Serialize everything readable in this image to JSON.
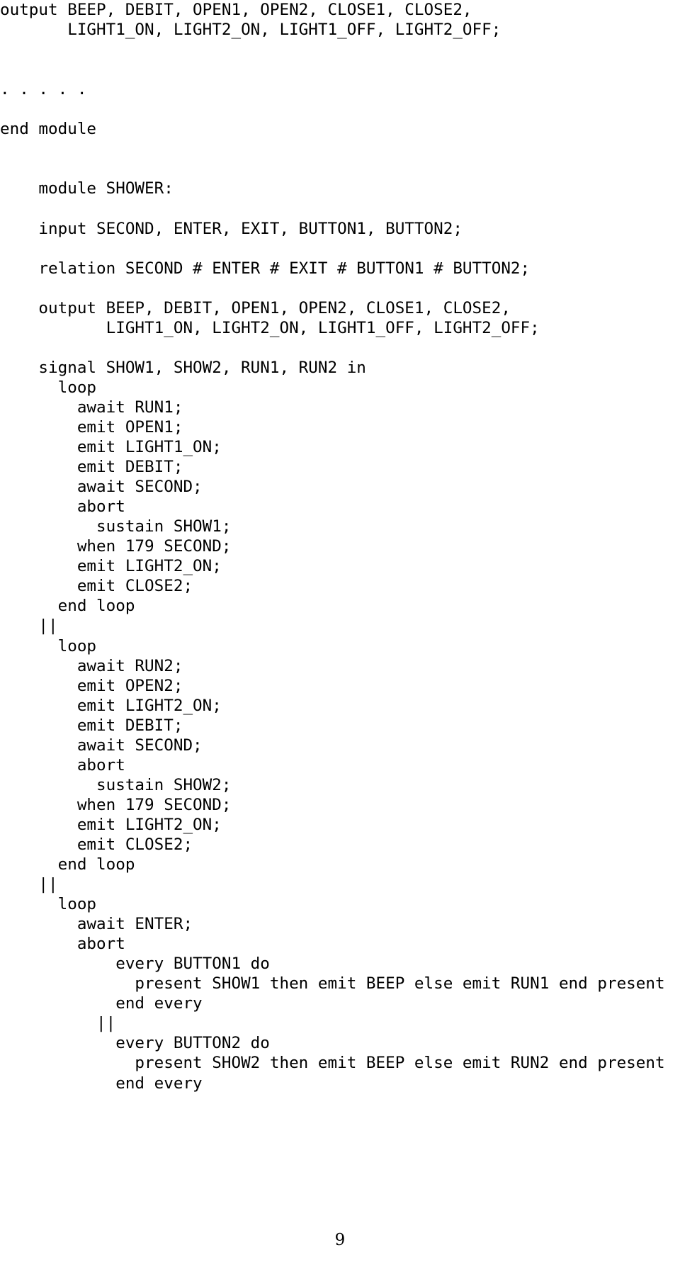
{
  "document": {
    "kind": "code-listing",
    "language": "Esterel",
    "page_number": "9",
    "ellipsis_marker": ". . . . ."
  },
  "listing": {
    "lines": [
      "output BEEP, DEBIT, OPEN1, OPEN2, CLOSE1, CLOSE2,",
      "       LIGHT1_ON, LIGHT2_ON, LIGHT1_OFF, LIGHT2_OFF;",
      "",
      "",
      ". . . . .",
      "",
      "end module",
      "",
      "",
      "    module SHOWER:",
      "",
      "    input SECOND, ENTER, EXIT, BUTTON1, BUTTON2;",
      "",
      "    relation SECOND # ENTER # EXIT # BUTTON1 # BUTTON2;",
      "",
      "    output BEEP, DEBIT, OPEN1, OPEN2, CLOSE1, CLOSE2,",
      "           LIGHT1_ON, LIGHT2_ON, LIGHT1_OFF, LIGHT2_OFF;",
      "",
      "    signal SHOW1, SHOW2, RUN1, RUN2 in",
      "      loop",
      "        await RUN1;",
      "        emit OPEN1;",
      "        emit LIGHT1_ON;",
      "        emit DEBIT;",
      "        await SECOND;",
      "        abort",
      "          sustain SHOW1;",
      "        when 179 SECOND;",
      "        emit LIGHT2_ON;",
      "        emit CLOSE2;",
      "      end loop",
      "    ||",
      "      loop",
      "        await RUN2;",
      "        emit OPEN2;",
      "        emit LIGHT2_ON;",
      "        emit DEBIT;",
      "        await SECOND;",
      "        abort",
      "          sustain SHOW2;",
      "        when 179 SECOND;",
      "        emit LIGHT2_ON;",
      "        emit CLOSE2;",
      "      end loop",
      "    ||",
      "      loop",
      "        await ENTER;",
      "        abort",
      "            every BUTTON1 do",
      "              present SHOW1 then emit BEEP else emit RUN1 end present",
      "            end every",
      "          ||",
      "            every BUTTON2 do",
      "              present SHOW2 then emit BEEP else emit RUN2 end present",
      "            end every"
    ]
  }
}
